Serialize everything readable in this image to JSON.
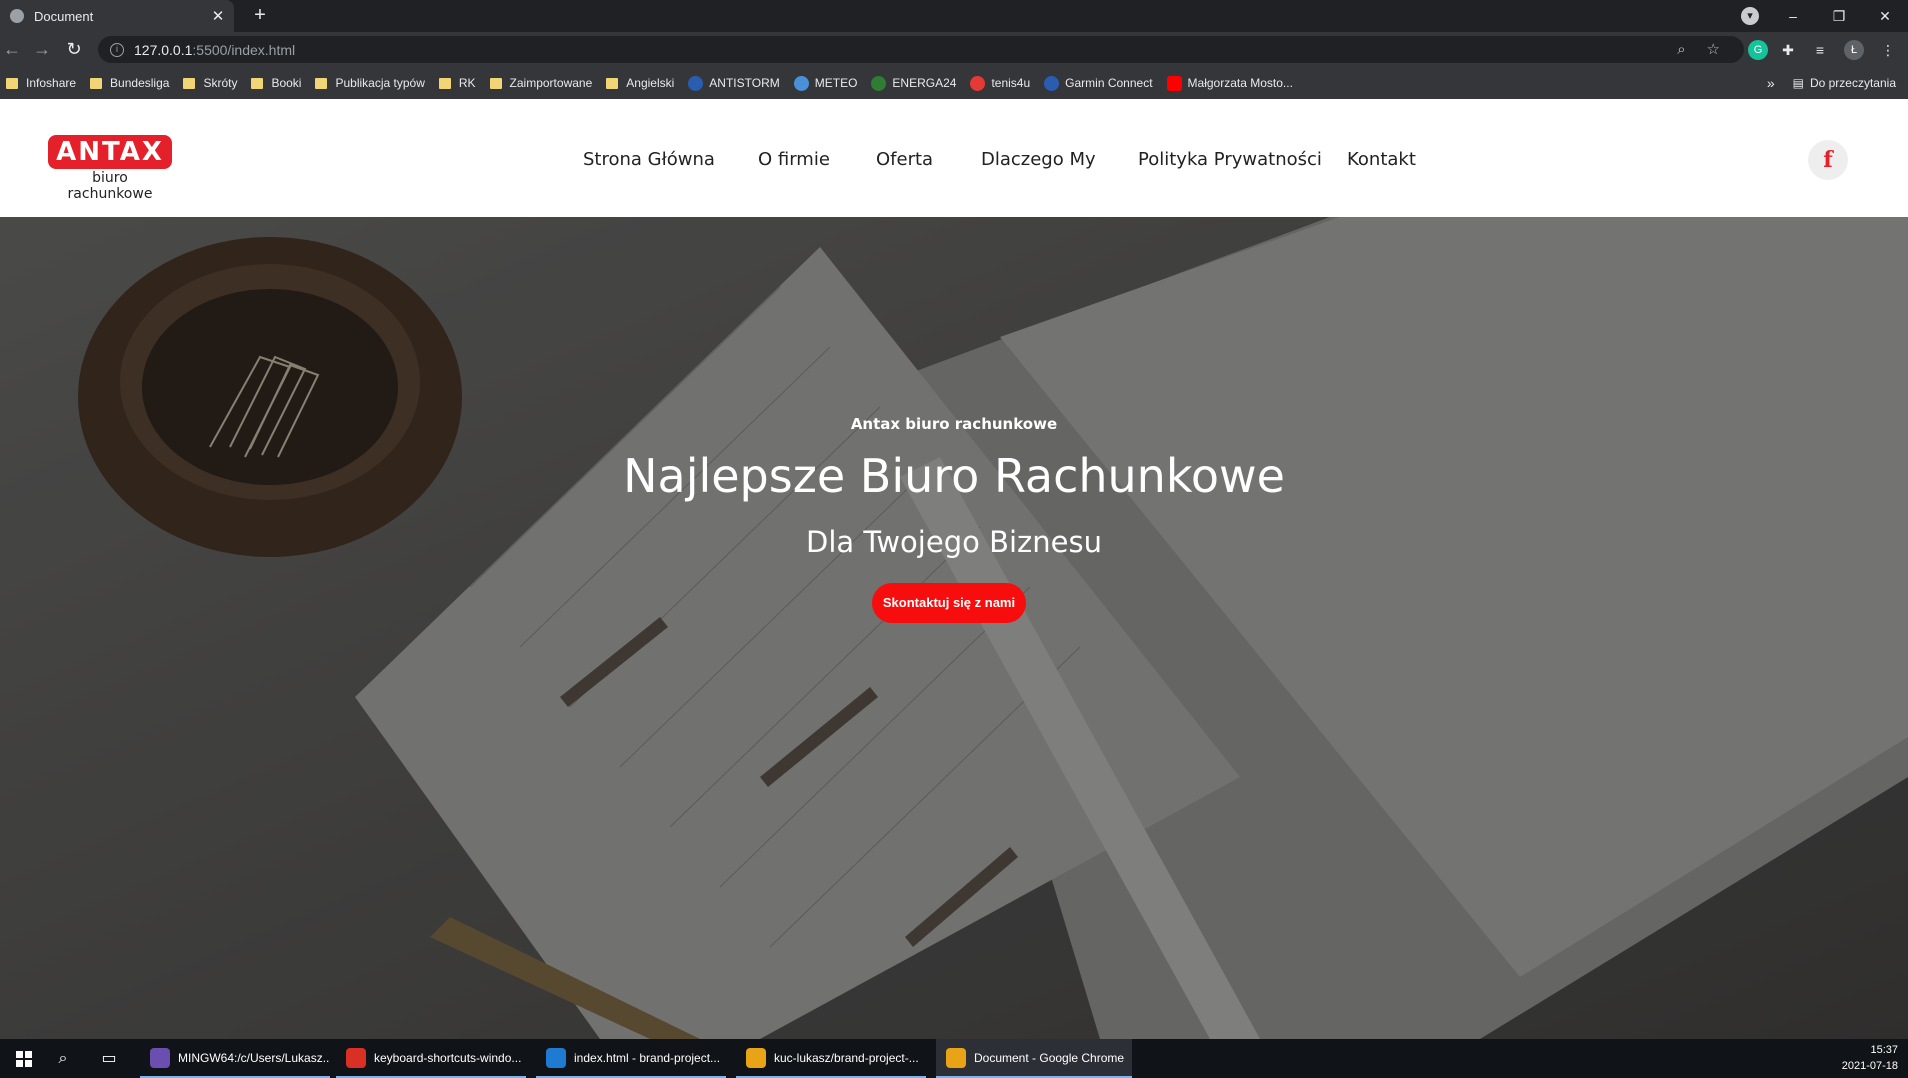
{
  "browser": {
    "tab_title": "Document",
    "tab_close": "✕",
    "new_tab": "+",
    "profile_initial": "",
    "window_controls": {
      "minimize": "–",
      "restore": "❐",
      "close": "✕"
    },
    "url_host": "127.0.0.1",
    "url_path": ":5500/index.html",
    "profile_letter": "Ł",
    "bookmarks": [
      {
        "label": "Infoshare",
        "icon": "folder-icon"
      },
      {
        "label": "Bundesliga",
        "icon": "folder-icon"
      },
      {
        "label": "Skróty",
        "icon": "folder-icon"
      },
      {
        "label": "Booki",
        "icon": "folder-icon"
      },
      {
        "label": "Publikacja typów",
        "icon": "folder-icon"
      },
      {
        "label": "RK",
        "icon": "folder-icon"
      },
      {
        "label": "Zaimportowane",
        "icon": "folder-icon"
      },
      {
        "label": "Angielski",
        "icon": "folder-icon"
      },
      {
        "label": "ANTISTORM",
        "icon": "site-icon"
      },
      {
        "label": "METEO",
        "icon": "site-icon"
      },
      {
        "label": "ENERGA24",
        "icon": "site-icon"
      },
      {
        "label": "tenis4u",
        "icon": "site-icon"
      },
      {
        "label": "Garmin Connect",
        "icon": "site-icon"
      },
      {
        "label": "Małgorzata Mosto...",
        "icon": "youtube-icon"
      }
    ],
    "bookmarks_overflow": "»",
    "reading_list": "Do przeczytania"
  },
  "site": {
    "logo_text": "ANTAX",
    "logo_sub": "biuro rachunkowe",
    "nav": [
      "Strona Główna",
      "O firmie",
      "Oferta",
      "Dlaczego My",
      "Polityka Prywatności",
      "Kontakt"
    ],
    "facebook_glyph": "f",
    "hero": {
      "kicker": "Antax biuro rachunkowe",
      "title": "Najlepsze Biuro Rachunkowe",
      "subtitle": "Dla Twojego Biznesu",
      "cta": "Skontaktuj się z nami"
    },
    "colors": {
      "accent": "#f70d0d",
      "logo_red": "#e4202a"
    }
  },
  "taskbar": {
    "apps": [
      {
        "label": "MINGW64:/c/Users/Lukasz...",
        "color": "#6a4fb0"
      },
      {
        "label": "keyboard-shortcuts-windo...",
        "color": "#d93025"
      },
      {
        "label": "index.html - brand-project...",
        "color": "#1f7ad1"
      },
      {
        "label": "kuc-lukasz/brand-project-...",
        "color": "#e8a317"
      },
      {
        "label": "Document - Google Chrome",
        "color": "#e8a317"
      }
    ],
    "time": "15:37",
    "date": "2021-07-18"
  }
}
